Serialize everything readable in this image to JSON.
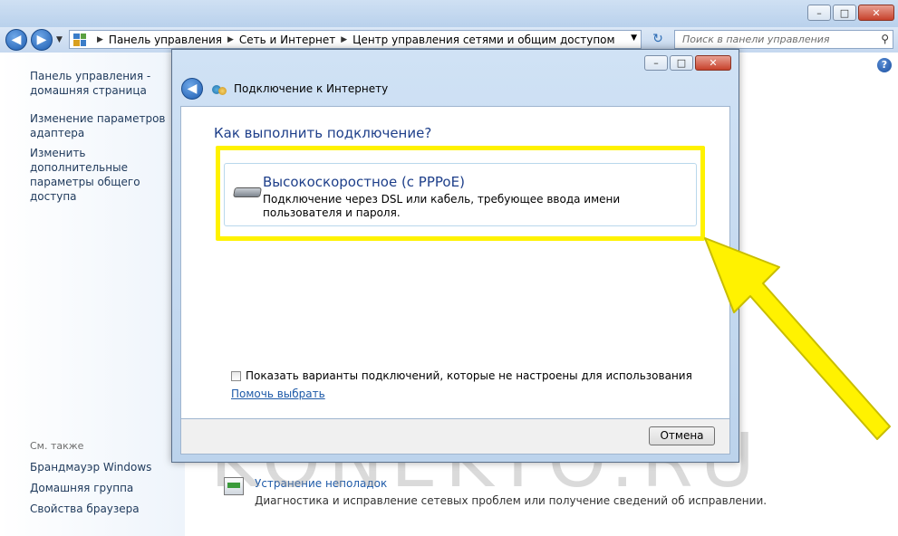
{
  "window": {
    "minimize": "–",
    "maximize": "□",
    "close": "✕"
  },
  "nav": {
    "back": "◀",
    "forward": "▶",
    "breadcrumbs": [
      "Панель управления",
      "Сеть и Интернет",
      "Центр управления сетями и общим доступом"
    ],
    "search_placeholder": "Поиск в панели управления"
  },
  "sidebar": {
    "items": [
      {
        "label": "Панель управления - домашняя страница"
      },
      {
        "label": "Изменение параметров адаптера"
      },
      {
        "label": "Изменить дополнительные параметры общего доступа"
      }
    ],
    "see_also_title": "См. также",
    "see_also": [
      {
        "label": "Брандмауэр Windows"
      },
      {
        "label": "Домашняя группа"
      },
      {
        "label": "Свойства браузера"
      }
    ]
  },
  "main": {
    "help": "?",
    "troubleshoot_link": "Устранение неполадок",
    "troubleshoot_desc": "Диагностика и исправление сетевых проблем или получение сведений об исправлении."
  },
  "dialog": {
    "title": "Подключение к Интернету",
    "question": "Как выполнить подключение?",
    "option_title": "Высокоскоростное (с PPPoE)",
    "option_desc": "Подключение через DSL или кабель, требующее ввода имени пользователя и пароля.",
    "checkbox_label": "Показать варианты подключений, которые не настроены для использования",
    "help_link": "Помочь выбрать",
    "cancel": "Отмена"
  },
  "watermark": "KONEKTO.RU",
  "colors": {
    "highlight": "#fff200",
    "link": "#1e5aa8",
    "heading": "#1e3f8a"
  }
}
